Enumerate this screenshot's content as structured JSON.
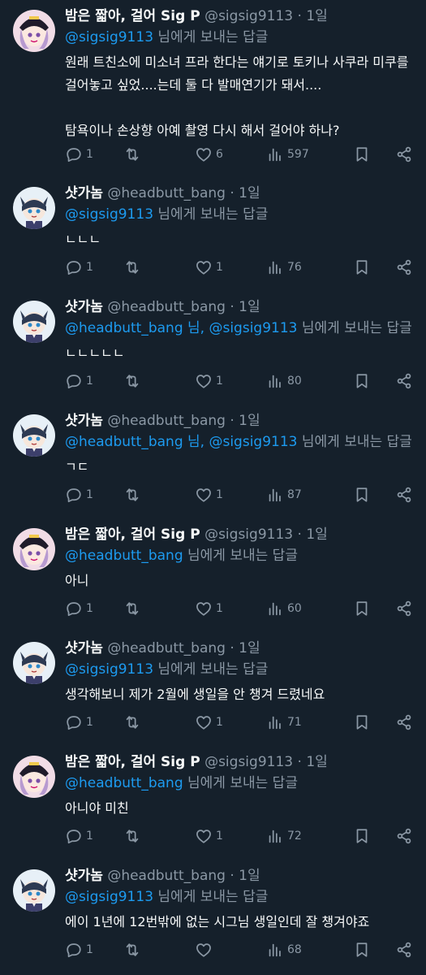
{
  "tweets": [
    {
      "name": "밤은 짧아, 걸어 Sig P",
      "handle": "@sigsig9113",
      "time": "1일",
      "reply_mentions": "@sigsig9113",
      "reply_suffix": "님에게 보내는 답글",
      "body": "원래 트친소에 미소녀 프라 한다는 얘기로 토키나 사쿠라 미쿠를 걸어놓고 싶었....는데 둘 다 발매연기가 돼서....\n\n탐욕이나 손상향 아예 촬영 다시 해서 걸어야 하나?",
      "replies": "1",
      "retweets": "",
      "likes": "6",
      "views": "597",
      "avatar": "sig"
    },
    {
      "name": "샷가놈",
      "handle": "@headbutt_bang",
      "time": "1일",
      "reply_mentions": "@sigsig9113",
      "reply_suffix": "님에게 보내는 답글",
      "body": "ㄴㄴㄴ",
      "replies": "1",
      "retweets": "",
      "likes": "1",
      "views": "76",
      "avatar": "bang"
    },
    {
      "name": "샷가놈",
      "handle": "@headbutt_bang",
      "time": "1일",
      "reply_mentions": "@headbutt_bang 님, @sigsig9113",
      "reply_suffix": "님에게 보내는 답글",
      "body": "ㄴㄴㄴㄴㄴ",
      "replies": "1",
      "retweets": "",
      "likes": "1",
      "views": "80",
      "avatar": "bang"
    },
    {
      "name": "샷가놈",
      "handle": "@headbutt_bang",
      "time": "1일",
      "reply_mentions": "@headbutt_bang 님, @sigsig9113",
      "reply_suffix": "님에게 보내는 답글",
      "body": "ㄱㄷ",
      "replies": "1",
      "retweets": "",
      "likes": "1",
      "views": "87",
      "avatar": "bang"
    },
    {
      "name": "밤은 짧아, 걸어 Sig P",
      "handle": "@sigsig9113",
      "time": "1일",
      "reply_mentions": "@headbutt_bang",
      "reply_suffix": "님에게 보내는 답글",
      "body": "아니",
      "replies": "1",
      "retweets": "",
      "likes": "1",
      "views": "60",
      "avatar": "sig"
    },
    {
      "name": "샷가놈",
      "handle": "@headbutt_bang",
      "time": "1일",
      "reply_mentions": "@sigsig9113",
      "reply_suffix": "님에게 보내는 답글",
      "body": "생각해보니 제가 2월에 생일을 안 챙겨 드렸네요",
      "replies": "1",
      "retweets": "",
      "likes": "1",
      "views": "71",
      "avatar": "bang"
    },
    {
      "name": "밤은 짧아, 걸어 Sig P",
      "handle": "@sigsig9113",
      "time": "1일",
      "reply_mentions": "@headbutt_bang",
      "reply_suffix": "님에게 보내는 답글",
      "body": "아니야 미친",
      "replies": "1",
      "retweets": "",
      "likes": "1",
      "views": "72",
      "avatar": "sig"
    },
    {
      "name": "샷가놈",
      "handle": "@headbutt_bang",
      "time": "1일",
      "reply_mentions": "@sigsig9113",
      "reply_suffix": "님에게 보내는 답글",
      "body": "에이 1년에 12번밖에 없는 시그님 생일인데 잘 챙겨야죠",
      "replies": "1",
      "retweets": "",
      "likes": "",
      "views": "68",
      "avatar": "bang"
    }
  ],
  "separator": "·",
  "icons": [
    "reply-icon",
    "retweet-icon",
    "like-icon",
    "views-icon",
    "bookmark-icon",
    "share-icon"
  ],
  "colors": {
    "background": "#15202b",
    "accent": "#1d9bf0",
    "muted": "#8b98a5",
    "text": "#f7f9f9"
  }
}
